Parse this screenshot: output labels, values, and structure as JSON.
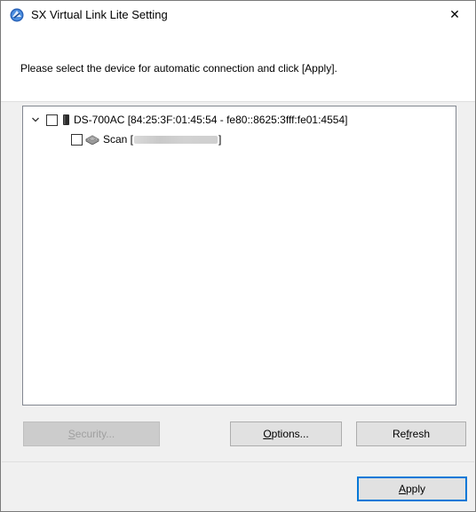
{
  "window": {
    "title": "SX Virtual Link Lite Setting",
    "close_glyph": "✕"
  },
  "instruction": "Please select the device for automatic connection and click [Apply].",
  "tree": {
    "device": {
      "expanded": true,
      "checked": false,
      "icon": "device-icon",
      "label": "DS-700AC [84:25:3F:01:45:54 - fe80::8625:3fff:fe01:4554]",
      "children": [
        {
          "checked": false,
          "icon": "scanner-icon",
          "label_prefix": "Scan [",
          "label_suffix": "]"
        }
      ]
    }
  },
  "buttons": {
    "security": {
      "mnemonic": "S",
      "rest": "ecurity...",
      "enabled": false
    },
    "options": {
      "mnemonic": "O",
      "rest": "ptions...",
      "enabled": true
    },
    "refresh": {
      "before": "Re",
      "mnemonic": "f",
      "after": "resh",
      "enabled": true
    },
    "apply": {
      "mnemonic": "A",
      "rest": "pply",
      "enabled": true,
      "default": true
    }
  },
  "colors": {
    "accent": "#0078d7",
    "window_bg": "#f0f0f0",
    "disabled_text": "#a0a0a0"
  }
}
